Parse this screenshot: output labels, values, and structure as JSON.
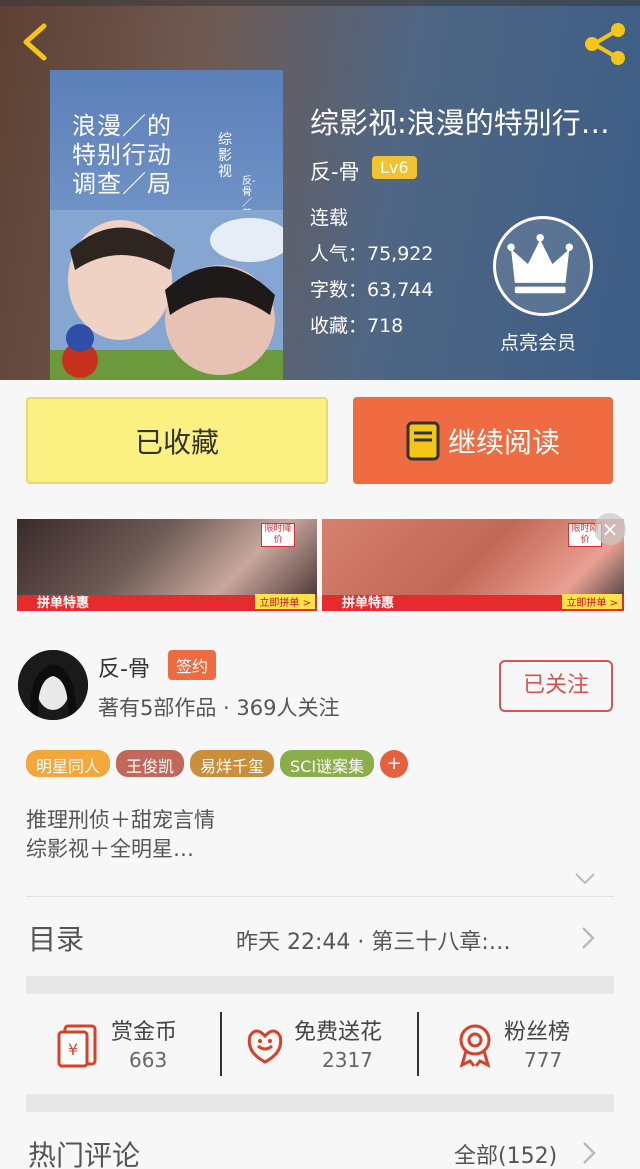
{
  "header": {
    "cover": {
      "title_lines": [
        "浪漫／的",
        "特别行动",
        "调查／局"
      ],
      "subtitle": "综影视",
      "author_mark": "反-骨／著"
    },
    "book_title": "综影视:浪漫的特别行…",
    "author": "反-骨",
    "level": "Lv6",
    "status": "连载",
    "popularity": "人气：75,922",
    "word_count": "字数：63,744",
    "favorites": "收藏：718",
    "vip_label": "点亮会员"
  },
  "actions": {
    "favorite_label": "已收藏",
    "read_label": "继续阅读"
  },
  "ad": {
    "banner_text": "拼单特惠",
    "cta": "立即拼单 >",
    "tag": "限时降价",
    "close": "×"
  },
  "author_block": {
    "name": "反-骨",
    "badge": "签约",
    "stats": "著有5部作品 · 369人关注",
    "follow_label": "已关注"
  },
  "tags": [
    {
      "label": "明星同人",
      "color": "#f4a73a"
    },
    {
      "label": "王俊凯",
      "color": "#c0685a"
    },
    {
      "label": "易烊千玺",
      "color": "#c98f3a"
    },
    {
      "label": "SCI谜案集",
      "color": "#8aae4a"
    }
  ],
  "tag_more": "+",
  "description": {
    "line1": "推理刑侦＋甜宠言情",
    "line2": "综影视＋全明星…"
  },
  "toc": {
    "label": "目录",
    "latest": "昨天 22:44 · 第三十八章:…"
  },
  "stats": [
    {
      "title": "赏金币",
      "value": "663",
      "icon": "red-envelope-icon"
    },
    {
      "title": "免费送花",
      "value": "2317",
      "icon": "flower-icon"
    },
    {
      "title": "粉丝榜",
      "value": "777",
      "icon": "ribbon-badge-icon"
    }
  ],
  "comments": {
    "label": "热门评论",
    "all": "全部(152)"
  },
  "colors": {
    "accent_orange": "#ef6b42",
    "favorite_yellow": "#fbf082",
    "level_badge": "#f1c232",
    "follow_red": "#d9534f"
  }
}
